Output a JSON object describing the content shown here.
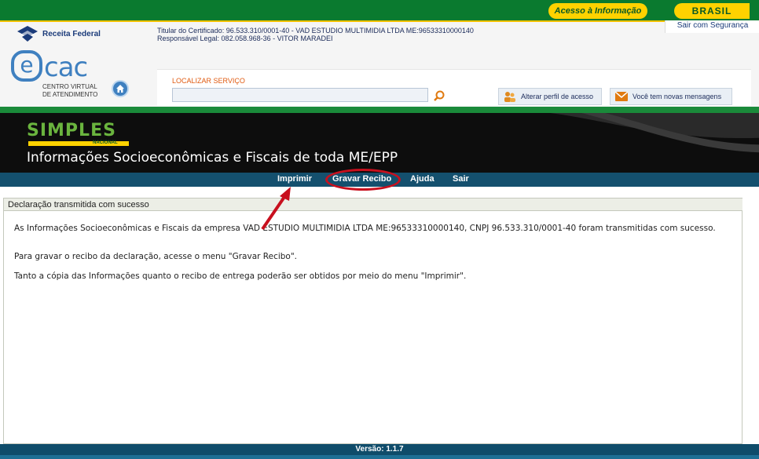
{
  "gov_bar": {
    "access_info": "Acesso à Informação",
    "brasil": "BRASIL"
  },
  "header": {
    "rf_name": "Receita Federal",
    "ecac_word": "cac",
    "ecac_e": "e",
    "ecac_subtitle_line1": "CENTRO VIRTUAL",
    "ecac_subtitle_line2": "DE ATENDIMENTO",
    "cert_holder": "Titular do Certificado: 96.533.310/0001-40 - VAD ESTUDIO MULTIMIDIA LTDA ME:96533310000140",
    "legal_responsible": "Responsável Legal: 082.058.968-36 - VITOR MARADEI",
    "logout": "Sair com Segurança",
    "search_label": "LOCALIZAR SERVIÇO",
    "search_value": "",
    "profile_button": "Alterar perfil de acesso",
    "messages_button": "Você tem novas mensagens"
  },
  "banner": {
    "logo_text": "SIMPLES",
    "logo_sub": "NACIONAL",
    "title": "Informações Socioeconômicas e Fiscais de toda ME/EPP"
  },
  "menu": {
    "items": [
      "Imprimir",
      "Gravar Recibo",
      "Ajuda",
      "Sair"
    ],
    "highlighted": "Gravar Recibo"
  },
  "content": {
    "header": "Declaração transmitida com sucesso",
    "paragraph1": "As Informações Socioeconômicas e Fiscais da empresa VAD ESTUDIO MULTIMIDIA LTDA ME:96533310000140, CNPJ 96.533.310/0001-40 foram transmitidas com sucesso.",
    "paragraph2": "Para gravar o recibo da declaração, acesse o menu \"Gravar Recibo\".",
    "paragraph3": "Tanto a cópia das Informações quanto o recibo de entrega poderão ser obtidos por meio do menu \"Imprimir\"."
  },
  "footer": {
    "version": "Versão: 1.1.7"
  },
  "colors": {
    "gov_green": "#0a7a2f",
    "gov_yellow": "#ffd200",
    "menu_blue": "#14506e",
    "annotation_red": "#c8101e",
    "ecac_blue": "#3f80c0"
  },
  "icons": [
    "receita-federal-emblem-icon",
    "home-icon",
    "search-icon",
    "profile-icon",
    "mail-icon",
    "arrow-annotation"
  ]
}
